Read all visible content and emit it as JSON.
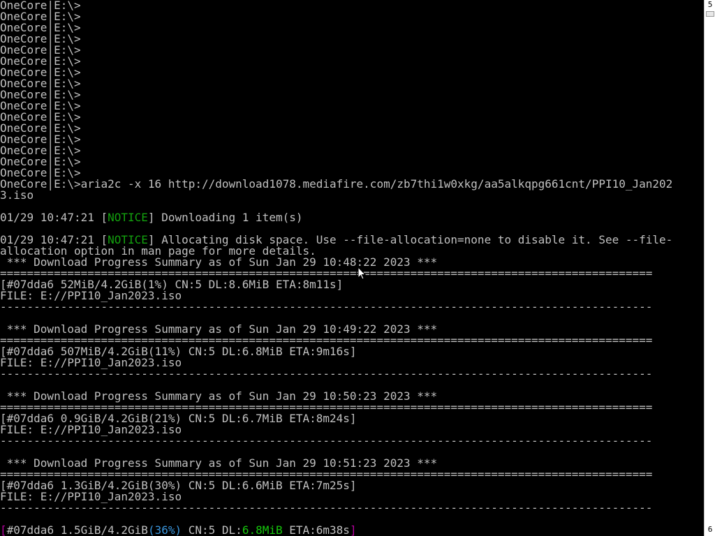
{
  "console": {
    "lines": [
      "OneCore|E:\\>",
      "OneCore|E:\\>",
      "OneCore|E:\\>",
      "OneCore|E:\\>",
      "OneCore|E:\\>",
      "OneCore|E:\\>",
      "OneCore|E:\\>",
      "OneCore|E:\\>",
      "OneCore|E:\\>",
      "OneCore|E:\\>",
      "OneCore|E:\\>",
      "OneCore|E:\\>",
      "OneCore|E:\\>",
      "OneCore|E:\\>",
      "OneCore|E:\\>",
      "OneCore|E:\\>",
      "OneCore|E:\\>aria2c -x 16 http://download1078.mediafire.com/zb7thi1w0xkg/aa5alkqpg661cnt/PPI10_Jan202",
      "3.iso",
      "",
      "",
      "",
      "allocation option in man page for more details.",
      " *** Download Progress Summary as of Sun Jan 29 10:48:22 2023 ***",
      "=================================================================================================",
      "",
      "FILE: E://PPI10_Jan2023.iso",
      "-------------------------------------------------------------------------------------------------",
      "",
      " *** Download Progress Summary as of Sun Jan 29 10:49:22 2023 ***",
      "=================================================================================================",
      "[#07dda6 507MiB/4.2GiB(11%) CN:5 DL:6.8MiB ETA:9m16s]",
      "FILE: E://PPI10_Jan2023.iso",
      "-------------------------------------------------------------------------------------------------",
      "",
      " *** Download Progress Summary as of Sun Jan 29 10:50:23 2023 ***",
      "=================================================================================================",
      "[#07dda6 0.9GiB/4.2GiB(21%) CN:5 DL:6.7MiB ETA:8m24s]",
      "FILE: E://PPI10_Jan2023.iso",
      "-------------------------------------------------------------------------------------------------",
      "",
      " *** Download Progress Summary as of Sun Jan 29 10:51:23 2023 ***",
      "=================================================================================================",
      "[#07dda6 1.3GiB/4.2GiB(30%) CN:5 DL:6.6MiB ETA:7m25s]",
      "FILE: E://PPI10_Jan2023.iso",
      "-------------------------------------------------------------------------------------------------",
      "",
      ""
    ],
    "notice1": {
      "prefix": "01/29 10:47:21 [",
      "tag": "NOTICE",
      "text": "] Downloading 1 item(s)"
    },
    "notice2": {
      "prefix": "01/29 10:47:21 [",
      "tag": "NOTICE",
      "text": "] Allocating disk space. Use --file-allocation=none to disable it. See --file-"
    },
    "first_progress": {
      "text": "[#07dda6 52MiB/4.2GiB(1%) CN:5 DL:8.6MiB ETA:8m11s]"
    },
    "live_status": {
      "open": "[",
      "id": "#07dda6 1.5GiB/4.2GiB",
      "percent": "(36%)",
      "cn": " CN:5 DL:",
      "speed": "6.8MiB",
      "eta": " ETA:6m38s",
      "close": "]"
    }
  },
  "scrollbar": {
    "top_label": "5",
    "bottom_label": "6"
  },
  "colors": {
    "background": "#000000",
    "text": "#c0c0c0",
    "notice": "#13a10e",
    "live_bracket": "#b4009e",
    "live_percent": "#3a96dd",
    "live_speed": "#16c60c"
  }
}
